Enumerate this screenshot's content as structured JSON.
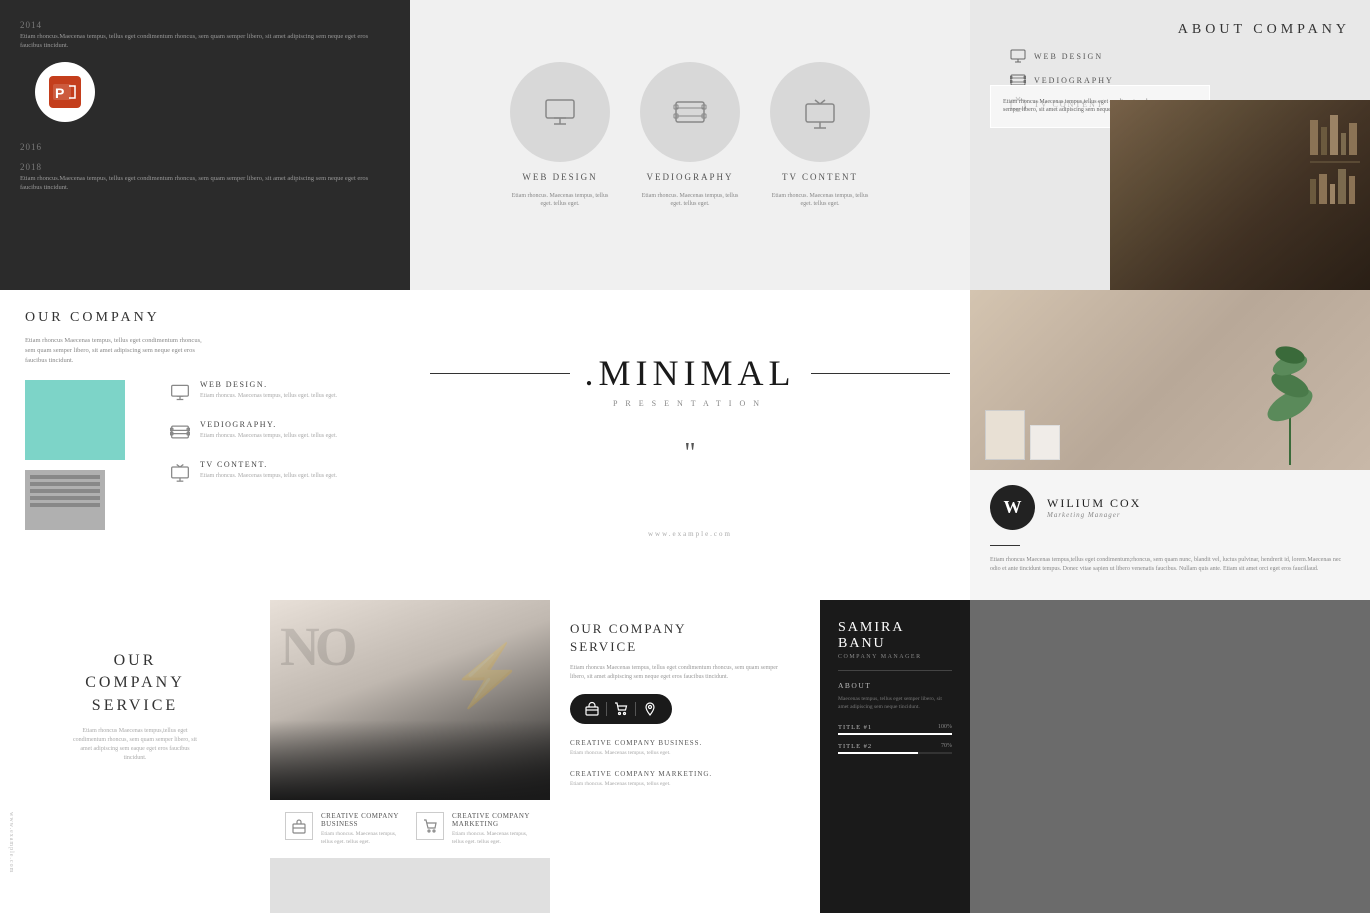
{
  "slides": {
    "s1": {
      "year1": "2014",
      "text1": "Etiam rhoncus.Maecenas tempus, tellus eget condimentum rhoncus, sem quam semper libero, sit amet adipiscing sem neque eget eros faucibus tincidunt.",
      "year2": "2016",
      "year3": "2018",
      "text3": "Etiam rhoncus.Maecenas tempus, tellus eget condimentum rhoncus, sem quam semper libero, sit amet adipiscing sem neque eget eros faucibus tincidunt."
    },
    "s2": {
      "circles": [
        {
          "icon": "monitor",
          "label": "WEB DESIGN",
          "desc": "Etiam rhoncus. Maecenas tempus, tellus eget. tellus eget."
        },
        {
          "icon": "film",
          "label": "VEDIOGRAPHY",
          "desc": "Etiam rhoncus. Maecenas tempus, tellus eget. tellus eget."
        },
        {
          "icon": "tv",
          "label": "TV CONTENT",
          "desc": "Etiam rhoncus. Maecenas tempus, tellus eget. tellus eget."
        }
      ]
    },
    "s3": {
      "title": "ABOUT COMPANY",
      "menu": [
        {
          "label": "WEB DESIGN"
        },
        {
          "label": "VEDIOGRAPHY"
        },
        {
          "label": "TV CONTENT"
        }
      ],
      "box_text": "Etiam rhoncus Maecenas tempus,tellus eget condimentum rhoncus, sem quam semper libero, sit amet adipiscing sem neque eget eros faucibus tincidunt."
    },
    "s4": {
      "title": "OUR COMPANY",
      "desc": "Etiam rhoncus Maecenas tempus, tellus eget condimentum rhoncus, sem quam semper libero, sit amet adipiscing sem neque eget eros faucibus tincidunt.",
      "services": [
        {
          "title": "WEB DESIGN.",
          "desc": "Etiam rhoncus. Maecenas tempus, tellus eget. tellus eget."
        },
        {
          "title": "VEDIOGRAPHY.",
          "desc": "Etiam rhoncus. Maecenas tempus, tellus eget. tellus eget."
        },
        {
          "title": "TV CONTENT.",
          "desc": "Etiam rhoncus. Maecenas tempus, tellus eget. tellus eget."
        }
      ]
    },
    "s5": {
      "title": ".MINIMAL",
      "subtitle": "PRESENTATION",
      "quote": "“”",
      "url": "www.example.com"
    },
    "s6": {
      "avatar_letter": "W",
      "name": "WILIUM COX",
      "role": "Marketing Manager",
      "bio": "Etiam rhoncus Maecenas tempus,tellus eget condimentum;rhoncus, sem quam nunc, blandit vel, luctus pulvinar, hendrerit id, lorem.Maecenas nec odio et ante tincidunt tempus. Donec vitae sapien ut libero venenatis faucibus. Nullam quis ante. Etiam sit amet orci eget eros faucillaud."
    },
    "s7": {
      "title": "OUR\nCOMPANY\nSERVICE",
      "desc": "Etiam rhoncus Maecenas\ntempus,tellus eget\ncondimentum rhoncus, sem\nquam semper libero, sit amet\nadipiscing sem eaque eget eros\nfaucibus tincidunt.",
      "www": "www.example.com"
    },
    "s8": {
      "no_text": "NO",
      "lightning": "⚡",
      "items": [
        {
          "title": "CREATIVE COMPANY BUSINESS",
          "desc": "Etiam rhoncus. Maecenas tempus, tellus eget. tellus eget."
        },
        {
          "title": "CREATIVE COMPANY MARKETING",
          "desc": "Etiam rhoncus. Maecenas tempus, tellus eget. tellus eget."
        }
      ]
    },
    "s9": {
      "title": "OUR COMPANY\nSERVICE",
      "desc": "Etiam rhoncus Maecenas tempus, tellus eget condimentum rhoncus, sem quam semper libero, sit amet adipiscing sem neque eget eros faucibus tincidunt.",
      "services": [
        {
          "title": "CREATIVE COMPANY BUSINESS.",
          "desc": "Etiam rhoncus. Maecenas tempus, tellus eget."
        },
        {
          "title": "CREATIVE COMPANY MARKETING.",
          "desc": "Etiam rhoncus. Maecenas tempus, tellus eget."
        }
      ]
    },
    "s10": {
      "name": "SAMIRA BANU",
      "role": "COMPANY MANAGER",
      "about_label": "ABOUT",
      "about_text": "Maecenas tempus, tellus eget semper libero, sit amet adipiscing sem neque tincidunt.",
      "skills": [
        {
          "title": "TITLE #1",
          "pct": 100,
          "pct_label": "100%"
        },
        {
          "title": "TITLE #2",
          "pct": 70,
          "pct_label": "70%"
        }
      ]
    }
  }
}
